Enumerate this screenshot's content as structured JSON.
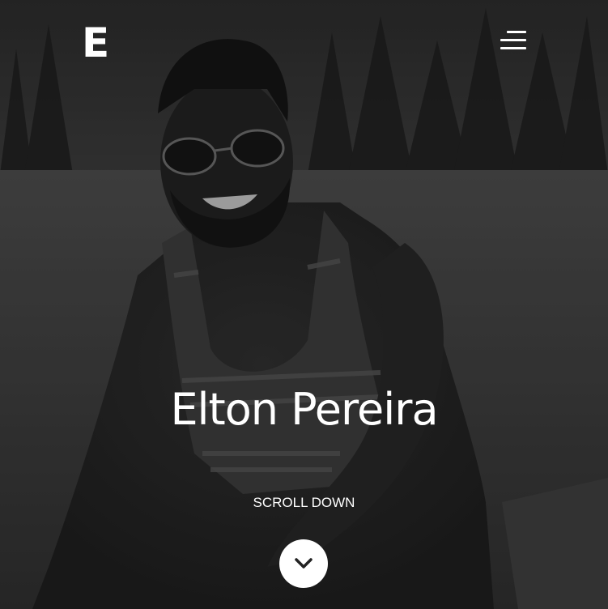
{
  "header": {
    "logo_text": "E"
  },
  "hero": {
    "name": "Elton Pereira",
    "scroll_label": "SCROLL DOWN"
  },
  "icons": {
    "menu": "hamburger-menu-icon",
    "scroll": "chevron-down-icon"
  },
  "colors": {
    "text": "#ffffff",
    "button_bg": "#ffffff",
    "chevron": "#222222"
  }
}
